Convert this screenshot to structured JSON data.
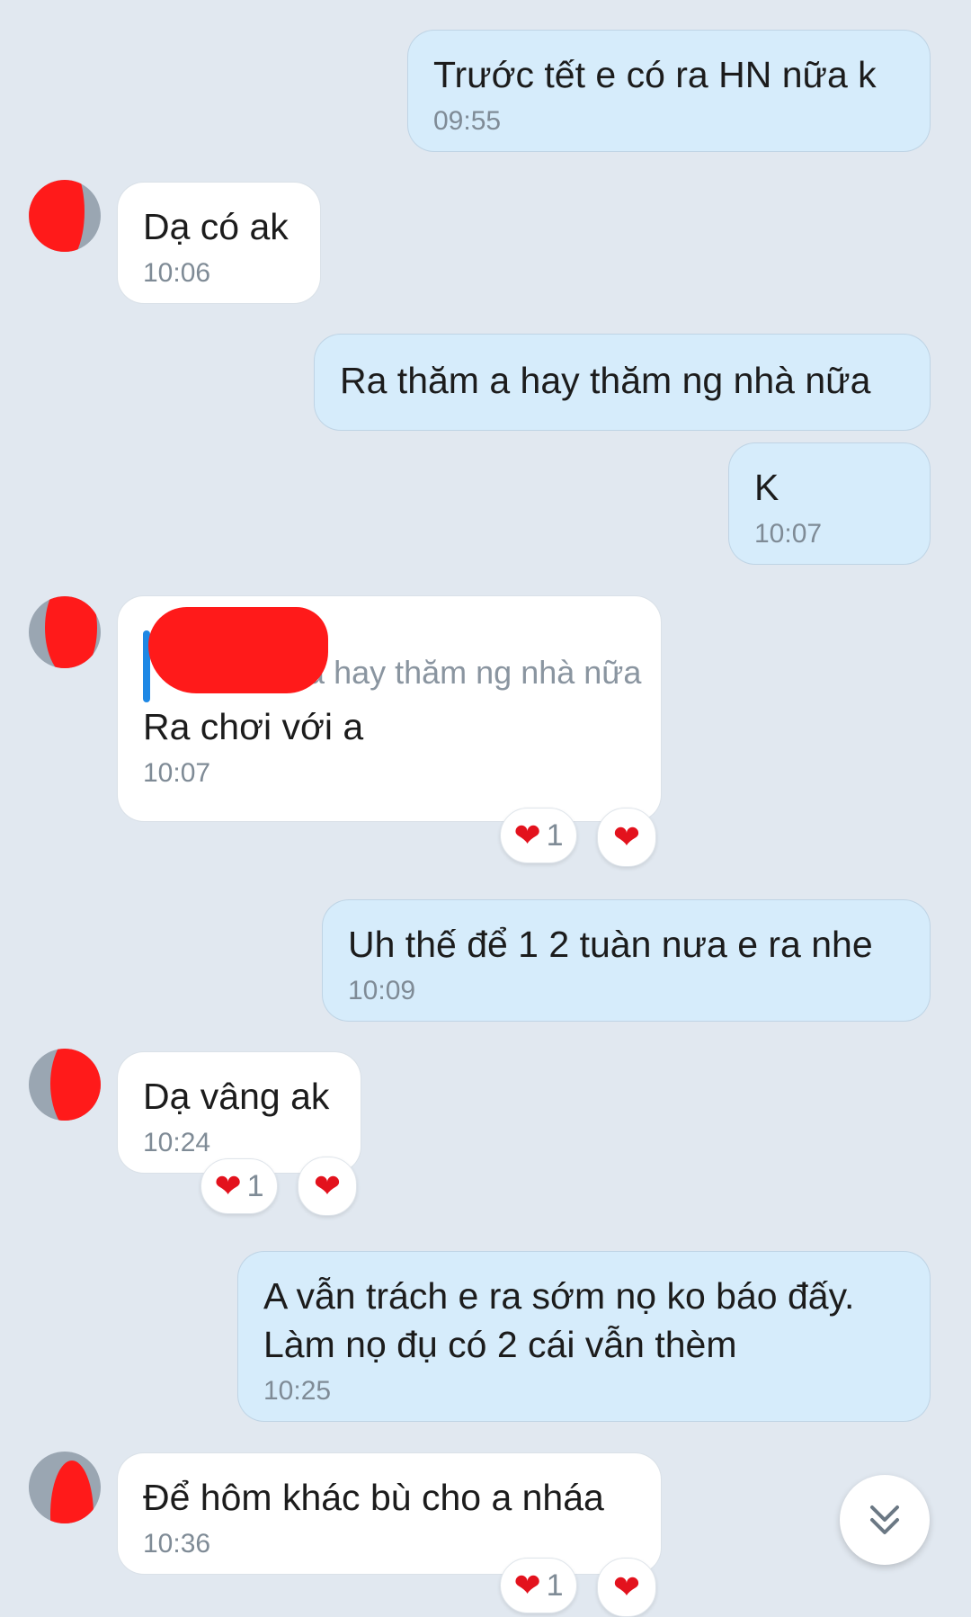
{
  "messages": [
    {
      "text": "Trước tết e có ra HN nữa k",
      "time": "09:55"
    },
    {
      "text": "Dạ có ak",
      "time": "10:06"
    },
    {
      "text": "Ra thăm a hay thăm ng nhà nữa"
    },
    {
      "text": "K",
      "time": "10:07"
    },
    {
      "reply_quote": "Ra thăm a hay thăm ng nhà nữa",
      "text": "Ra chơi với a",
      "time": "10:07",
      "reaction_count": "1"
    },
    {
      "text": "Uh thế để 1 2 tuàn nưa e ra nhe",
      "time": "10:09"
    },
    {
      "text": "Dạ vâng ak",
      "time": "10:24",
      "reaction_count": "1"
    },
    {
      "text": "A vẫn trách e ra sớm nọ ko báo đấy.\nLàm nọ đụ có 2 cái vẫn thèm",
      "time": "10:25"
    },
    {
      "text": "Để hôm khác bù cho a nháa",
      "time": "10:36",
      "reaction_count": "1"
    }
  ],
  "colors": {
    "background": "#e1e8f0",
    "outgoing_bubble": "#d6ecfb",
    "incoming_bubble": "#ffffff",
    "reaction_heart": "#e3121d",
    "reply_bar": "#1e88e5"
  },
  "icons": {
    "reaction": "heart-icon",
    "scroll_down": "double-chevron-down-icon"
  }
}
